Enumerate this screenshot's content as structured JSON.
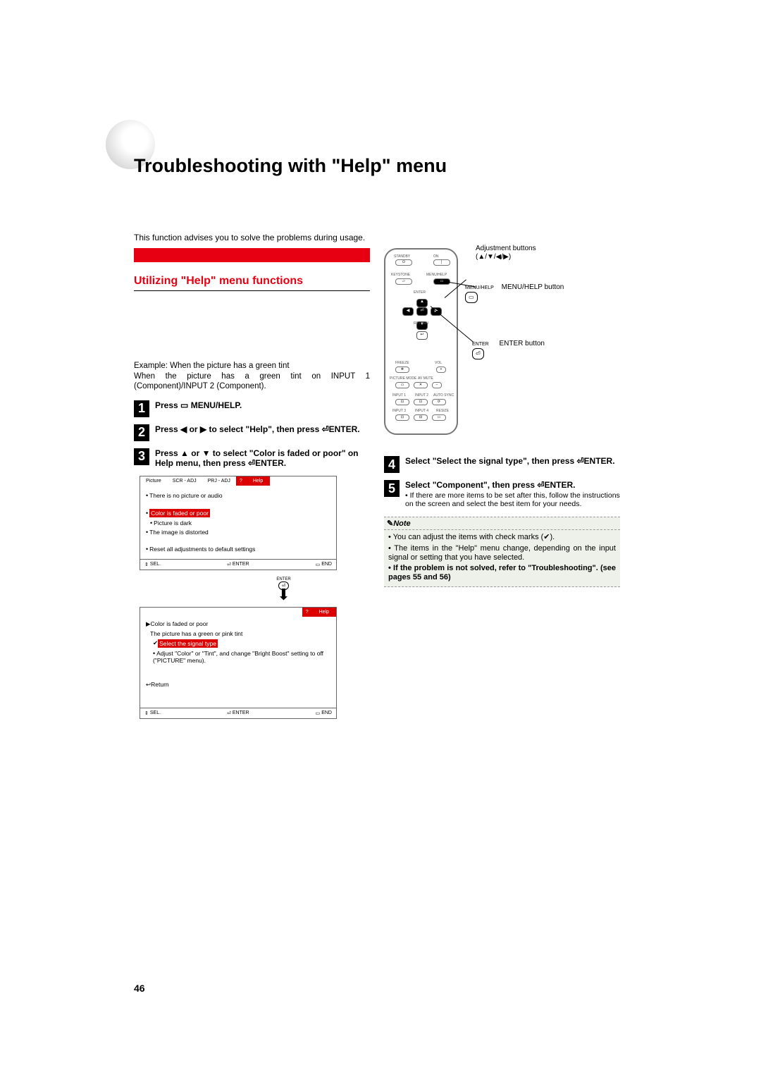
{
  "page_number": "46",
  "main_title": "Troubleshooting with \"Help\" menu",
  "intro": "This function advises you to solve the problems during usage.",
  "section_title": "Utilizing \"Help\" menu functions",
  "example_label": "Example: When the picture has a green tint",
  "example_body": "When the picture has a green tint on INPUT 1 (Component)/INPUT 2 (Component).",
  "steps": {
    "s1": "Press ▭ MENU/HELP.",
    "s2": "Press ◀ or ▶ to select \"Help\", then press ⏎ENTER.",
    "s3": "Press ▲ or ▼ to select \"Color is faded or poor\" on Help menu, then press ⏎ENTER.",
    "s4": "Select \"Select the signal type\", then press ⏎ENTER.",
    "s5": "Select \"Component\", then press ⏎ENTER.",
    "s5_sub": "If there are more items to be set after this, follow the instructions on the screen and select the best item for your needs."
  },
  "osd1": {
    "tabs": [
      "Picture",
      "SCR - ADJ",
      "PRJ - ADJ",
      "?",
      "Help"
    ],
    "line1": "There is no picture or audio",
    "hl": "Color is faded or poor",
    "line2": "Picture is dark",
    "line3": "The image is distorted",
    "line4": "Reset all adjustments to default settings",
    "bar": {
      "sel": "SEL.",
      "enter": "ENTER",
      "end": "END"
    }
  },
  "osd2": {
    "tabs": [
      "?",
      "Help"
    ],
    "title": "Color is faded or poor",
    "line1": "The picture has a green or pink tint",
    "hl": "Select the signal type",
    "line2": "Adjust \"Color\" or \"Tint\", and change \"Bright Boost\" setting to off (\"PICTURE\" menu).",
    "return": "Return",
    "bar": {
      "sel": "SEL.",
      "enter": "ENTER",
      "end": "END"
    }
  },
  "callouts": {
    "adj": "Adjustment buttons",
    "adj_sym": "(▲/▼/◀/▶)",
    "mh_small": "MENU/HELP",
    "mh": "MENU/HELP button",
    "enter_small": "ENTER",
    "enter": "ENTER button"
  },
  "remote_labels": {
    "standby": "STANDBY",
    "on": "ON",
    "keystone": "KEYSTONE",
    "menuhelp": "MENU/HELP",
    "enter": "ENTER",
    "return": "RETURN",
    "freeze": "FREEZE",
    "vol": "VOL",
    "picmode": "PICTURE MODE",
    "avmute": "AV MUTE",
    "in1": "INPUT 1",
    "in2": "INPUT 2",
    "autosync": "AUTO SYNC",
    "in3": "INPUT 3",
    "in4": "INPUT 4",
    "resize": "RESIZE"
  },
  "note": {
    "title": "Note",
    "b1": "You can adjust the items with check marks (✔).",
    "b2": "The items in the \"Help\" menu change, depending on the input signal or setting that you have selected.",
    "b3": "If the problem is not solved, refer to \"Troubleshooting\". (see pages 55 and 56)"
  }
}
